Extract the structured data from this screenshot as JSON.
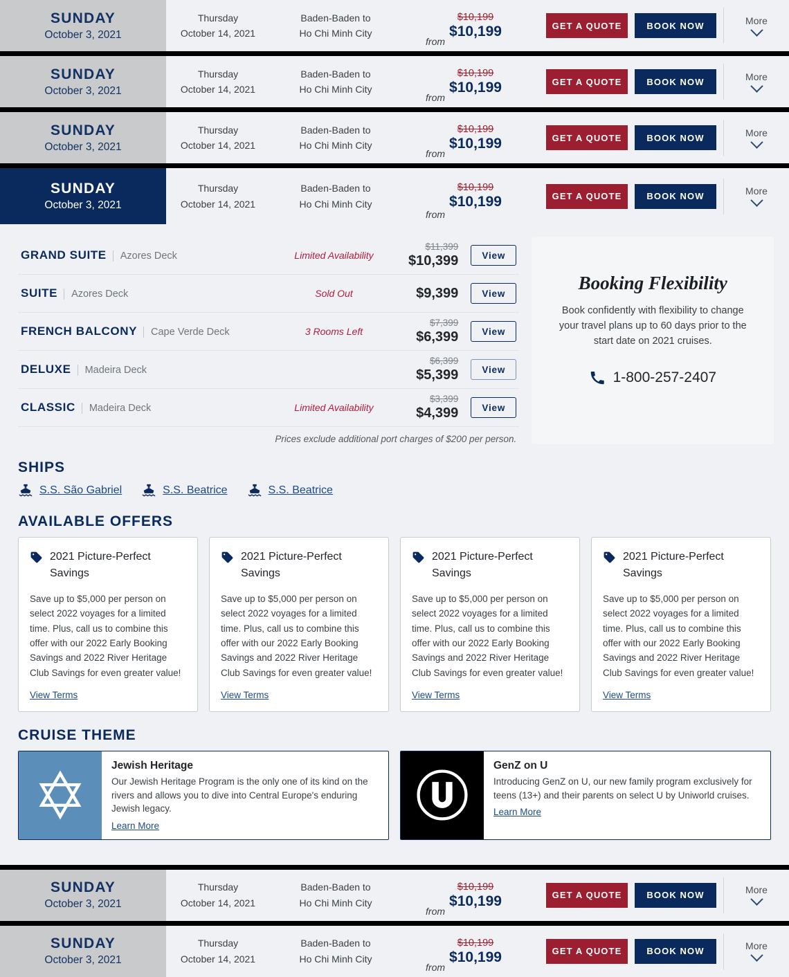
{
  "rows": [
    {
      "dow": "SUNDAY",
      "date": "October 3, 2021",
      "end_dow": "Thursday",
      "end_date": "October 14, 2021",
      "route_from": "Baden-Baden to",
      "route_to": "Ho Chi Minh City",
      "from_label": "from",
      "was": "$10,199",
      "now": "$10,199",
      "quote": "Get a Quote",
      "book": "Book Now",
      "more": "More",
      "active": false
    },
    {
      "dow": "SUNDAY",
      "date": "October 3, 2021",
      "end_dow": "Thursday",
      "end_date": "October 14, 2021",
      "route_from": "Baden-Baden to",
      "route_to": "Ho Chi Minh City",
      "from_label": "from",
      "was": "$10,199",
      "now": "$10,199",
      "quote": "Get a Quote",
      "book": "Book Now",
      "more": "More",
      "active": false
    },
    {
      "dow": "SUNDAY",
      "date": "October 3, 2021",
      "end_dow": "Thursday",
      "end_date": "October 14, 2021",
      "route_from": "Baden-Baden to",
      "route_to": "Ho Chi Minh City",
      "from_label": "from",
      "was": "$10,199",
      "now": "$10,199",
      "quote": "Get a Quote",
      "book": "Book Now",
      "more": "More",
      "active": false
    },
    {
      "dow": "SUNDAY",
      "date": "October 3, 2021",
      "end_dow": "Thursday",
      "end_date": "October 14, 2021",
      "route_from": "Baden-Baden to",
      "route_to": "Ho Chi Minh City",
      "from_label": "from",
      "was": "$10,199",
      "now": "$10,199",
      "quote": "Get a Quote",
      "book": "Book Now",
      "more": "More",
      "active": true
    }
  ],
  "bottom_rows": [
    {
      "dow": "SUNDAY",
      "date": "October 3, 2021",
      "end_dow": "Thursday",
      "end_date": "October 14, 2021",
      "route_from": "Baden-Baden to",
      "route_to": "Ho Chi Minh City",
      "from_label": "from",
      "was": "$10,199",
      "now": "$10,199",
      "quote": "Get a Quote",
      "book": "Book Now",
      "more": "More"
    },
    {
      "dow": "SUNDAY",
      "date": "October 3, 2021",
      "end_dow": "Thursday",
      "end_date": "October 14, 2021",
      "route_from": "Baden-Baden to",
      "route_to": "Ho Chi Minh City",
      "from_label": "from",
      "was": "$10,199",
      "now": "$10,199",
      "quote": "Get a Quote",
      "book": "Book Now",
      "more": "More"
    }
  ],
  "cabins": {
    "view_label": "View",
    "port_note": "Prices exclude additional port charges of $200 per person.",
    "items": [
      {
        "name": "Grand Suite",
        "deck": "Azores Deck",
        "availability": "Limited Availability",
        "was": "$11,399",
        "now": "$10,399",
        "hovered": false
      },
      {
        "name": "Suite",
        "deck": "Azores Deck",
        "availability": "Sold Out",
        "was": "",
        "now": "$9,399",
        "hovered": false
      },
      {
        "name": "French Balcony",
        "deck": "Cape Verde Deck",
        "availability": "3 Rooms Left",
        "was": "$7,399",
        "now": "$6,399",
        "hovered": false
      },
      {
        "name": "Deluxe",
        "deck": "Madeira Deck",
        "availability": "",
        "was": "$6,399",
        "now": "$5,399",
        "hovered": true
      },
      {
        "name": "Classic",
        "deck": "Madeira Deck",
        "availability": "Limited Availability",
        "was": "$3,399",
        "now": "$4,399",
        "hovered": false
      }
    ]
  },
  "booking_flexibility": {
    "title": "Booking Flexibility",
    "body": "Book confidently with flexibility to change your travel plans up to 60 days prior to the start date on 2021 cruises.",
    "phone": "1-800-257-2407"
  },
  "ships": {
    "heading": "Ships",
    "items": [
      {
        "name": "S.S. São Gabriel"
      },
      {
        "name": "S.S. Beatrice"
      },
      {
        "name": "S.S. Beatrice"
      }
    ]
  },
  "offers": {
    "heading": "Available Offers",
    "terms_label": "View Terms",
    "items": [
      {
        "title": "2021 Picture-Perfect Savings",
        "body": "Save up to $5,000 per person on select 2022 voyages for a limited time. Plus, call us to combine this offer with our 2022 Early Booking Savings and 2022 River Heritage Club Savings for even greater value!"
      },
      {
        "title": "2021 Picture-Perfect Savings",
        "body": "Save up to $5,000 per person on select 2022 voyages for a limited time. Plus, call us to combine this offer with our 2022 Early Booking Savings and 2022 River Heritage Club Savings for even greater value!"
      },
      {
        "title": "2021 Picture-Perfect Savings",
        "body": "Save up to $5,000 per person on select 2022 voyages for a limited time. Plus, call us to combine this offer with our 2022 Early Booking Savings and 2022 River Heritage Club Savings for even greater value!"
      },
      {
        "title": "2021 Picture-Perfect Savings",
        "body": "Save up to $5,000 per person on select 2022 voyages for a limited time. Plus, call us to combine this offer with our 2022 Early Booking Savings and 2022 River Heritage Club Savings for even greater value!"
      }
    ]
  },
  "themes": {
    "heading": "Cruise Theme",
    "learn_more_label": "Learn More",
    "items": [
      {
        "name": "Jewish Heritage",
        "desc": "Our Jewish Heritage Program is the only one of its kind on the rivers and allows you to dive into Central Europe's enduring Jewish legacy.",
        "icon": "star-of-david-icon",
        "icon_bg": "#5b8fb9"
      },
      {
        "name": "GenZ on U",
        "desc": "Introducing GenZ on U, our new family program exclusively for teens (13+) and their parents on select U by Uniworld cruises.",
        "icon": "letter-u-circle-icon",
        "icon_bg": "#000000"
      }
    ]
  },
  "colors": {
    "navy": "#0a2a5e",
    "crimson": "#9b1f30",
    "link": "#1a4a8c",
    "page_bg": "#eff1f4",
    "date_bg": "#c9cacb",
    "alert_red": "#b51b3e"
  }
}
